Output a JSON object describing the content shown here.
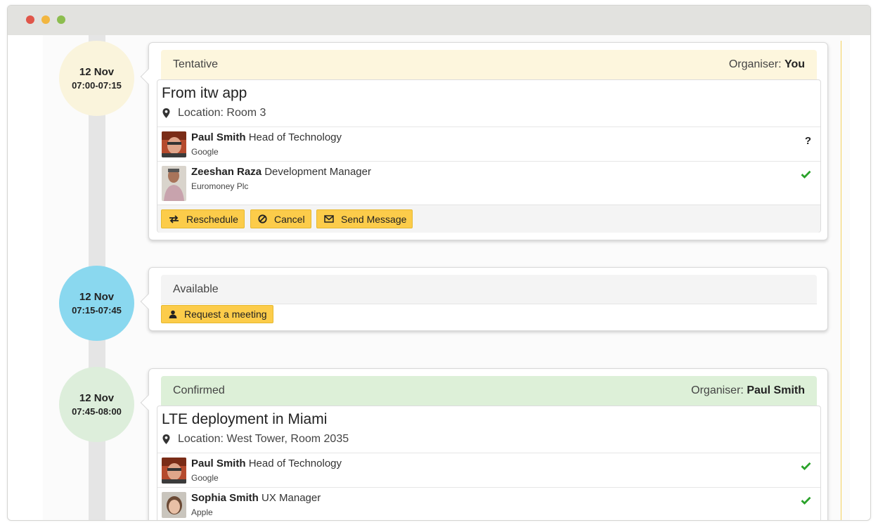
{
  "window": {
    "controls": {
      "close_color": "#e0564a",
      "minimize_color": "#f2b640",
      "maximize_color": "#8cbd4f"
    }
  },
  "colors": {
    "tentative_bg": "#fdf6dd",
    "available_bg": "#f4f4f4",
    "confirmed_bg": "#ddf0d8",
    "button": "#fccc4a",
    "accepted_check": "#2aa22a",
    "circle_tentative": "#faf4dc",
    "circle_available": "#8ad8ef",
    "circle_confirmed": "#ddeedb"
  },
  "slots": [
    {
      "date": "12 Nov",
      "time": "07:00-07:15",
      "status": "Tentative",
      "organiser_label": "Organiser:",
      "organiser": "You",
      "title": "From itw app",
      "location_label": "Location:",
      "location": "Room 3",
      "attendees": [
        {
          "name": "Paul Smith",
          "role": "Head of Technology",
          "company": "Google",
          "response": "?",
          "response_icon": "question-icon"
        },
        {
          "name": "Zeeshan Raza",
          "role": "Development Manager",
          "company": "Euromoney Plc",
          "response": "",
          "response_icon": "check-icon"
        }
      ],
      "actions": [
        {
          "label": "Reschedule",
          "icon": "swap-arrows-icon"
        },
        {
          "label": "Cancel",
          "icon": "ban-icon"
        },
        {
          "label": "Send Message",
          "icon": "envelope-icon"
        }
      ]
    },
    {
      "date": "12 Nov",
      "time": "07:15-07:45",
      "status": "Available",
      "actions": [
        {
          "label": "Request a meeting",
          "icon": "user-icon"
        }
      ]
    },
    {
      "date": "12 Nov",
      "time": "07:45-08:00",
      "status": "Confirmed",
      "organiser_label": "Organiser:",
      "organiser": "Paul Smith",
      "title": "LTE deployment in Miami",
      "location_label": "Location:",
      "location": "West Tower, Room 2035",
      "attendees": [
        {
          "name": "Paul Smith",
          "role": "Head of Technology",
          "company": "Google",
          "response": "",
          "response_icon": "check-icon"
        },
        {
          "name": "Sophia Smith",
          "role": "UX Manager",
          "company": "Apple",
          "response": "",
          "response_icon": "check-icon"
        }
      ]
    }
  ]
}
